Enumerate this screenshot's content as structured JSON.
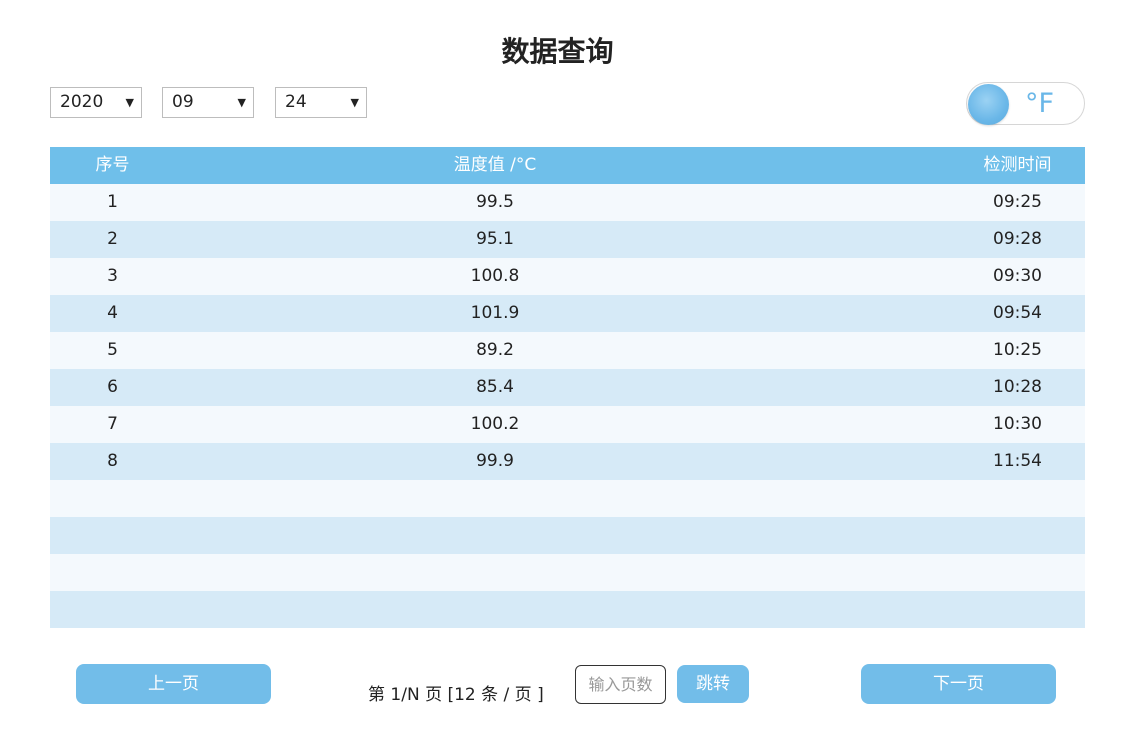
{
  "title": "数据查询",
  "filters": {
    "year": "2020",
    "month": "09",
    "day": "24",
    "caret": "▼"
  },
  "unit_toggle": {
    "label": "°F"
  },
  "table": {
    "headers": [
      "序号",
      "温度值 /°C",
      "检测时间"
    ],
    "rows": [
      [
        "1",
        "99.5",
        "09:25"
      ],
      [
        "2",
        "95.1",
        "09:28"
      ],
      [
        "3",
        "100.8",
        "09:30"
      ],
      [
        "4",
        "101.9",
        "09:54"
      ],
      [
        "5",
        "89.2",
        "10:25"
      ],
      [
        "6",
        "85.4",
        "10:28"
      ],
      [
        "7",
        "100.2",
        "10:30"
      ],
      [
        "8",
        "99.9",
        "11:54"
      ],
      [
        "",
        "",
        ""
      ],
      [
        "",
        "",
        ""
      ],
      [
        "",
        "",
        ""
      ],
      [
        "",
        "",
        ""
      ]
    ]
  },
  "pagination": {
    "prev_label": "上一页",
    "info": "第 1/N 页 [12 条 / 页 ]",
    "input_placeholder": "输入页数",
    "input_value": "",
    "jump_label": "跳转",
    "next_label": "下一页"
  },
  "colors": {
    "accent": "#6fbfea",
    "row_odd": "#f4f9fd",
    "row_even": "#d6eaf7"
  }
}
